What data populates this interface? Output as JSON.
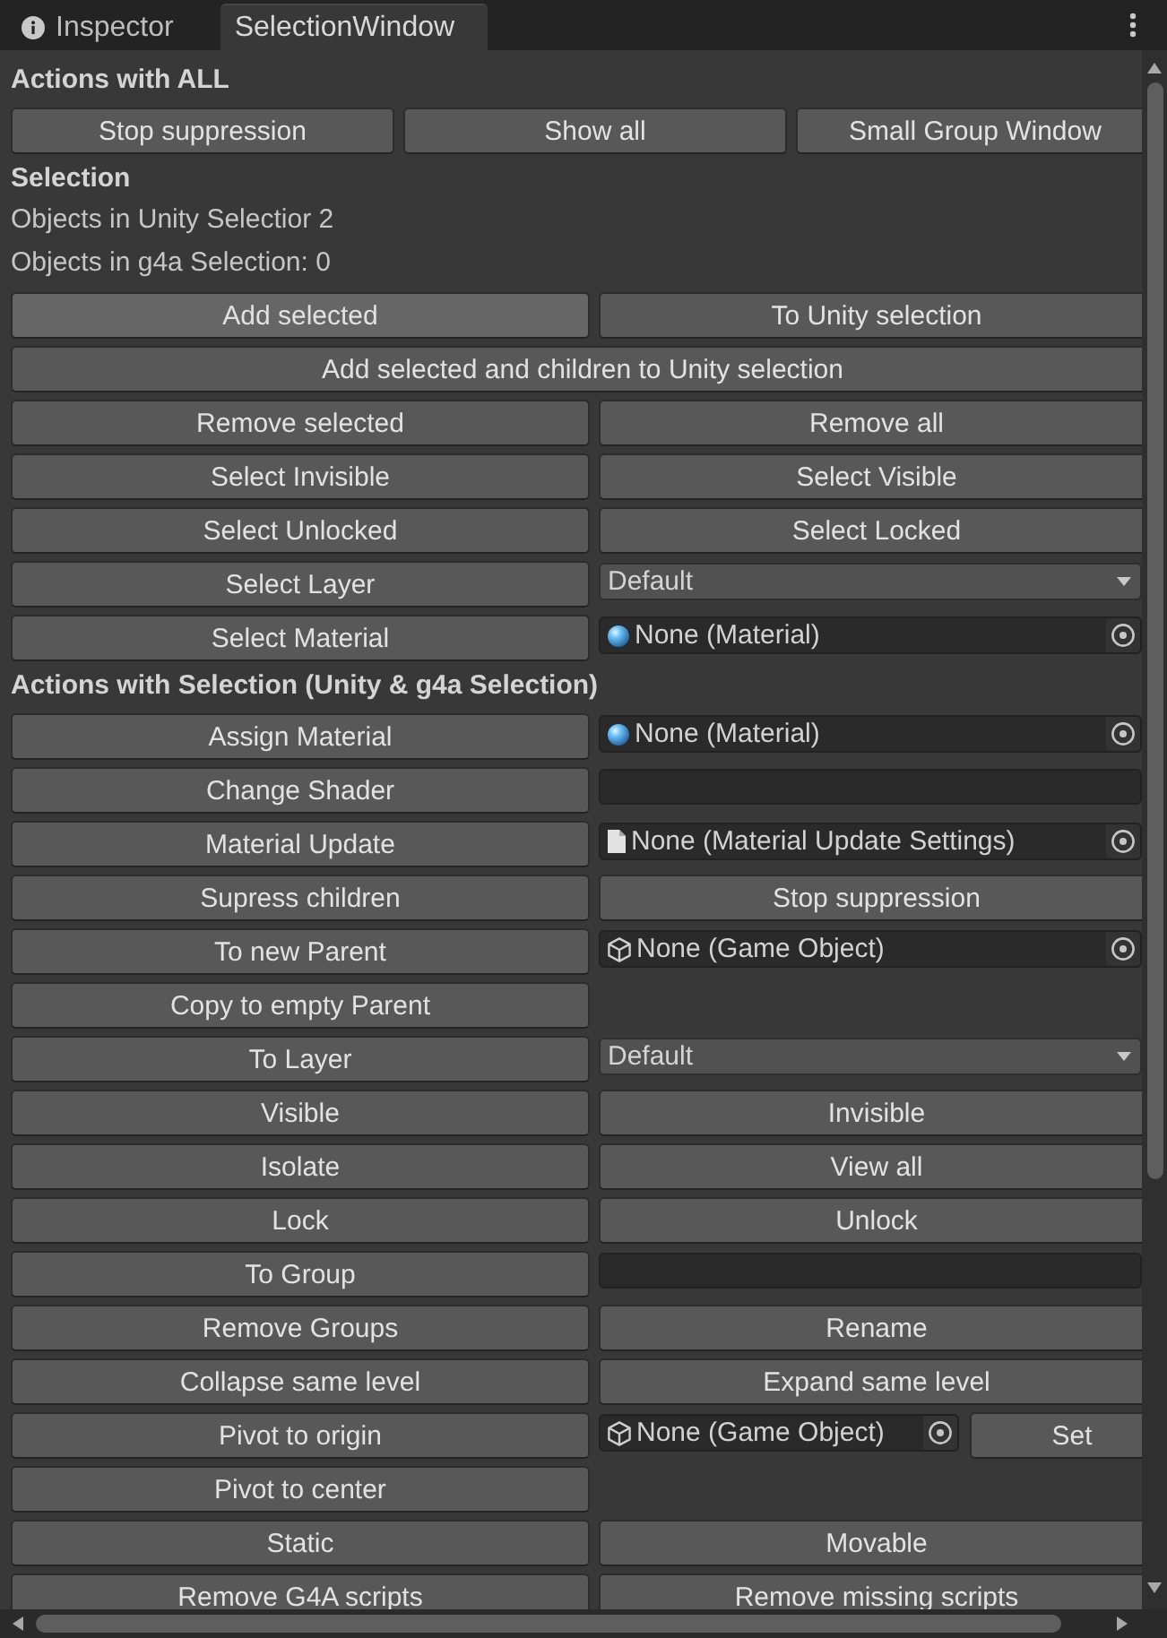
{
  "tabs": [
    {
      "label": "Inspector",
      "selected": false,
      "has_icon": true
    },
    {
      "label": "SelectionWindow",
      "selected": true,
      "has_icon": false
    }
  ],
  "content": [
    {
      "kind": "heading",
      "text": "Actions with ALL"
    },
    {
      "kind": "thirds",
      "cells": [
        {
          "kind": "button",
          "label": "Stop suppression",
          "hovered": false
        },
        {
          "kind": "button",
          "label": "Show all",
          "hovered": false
        },
        {
          "kind": "button",
          "label": "Small Group Window",
          "hovered": false
        }
      ]
    },
    {
      "kind": "heading",
      "text": "Selection"
    },
    {
      "kind": "text",
      "text": "Objects in Unity Selectior 2"
    },
    {
      "kind": "text",
      "text": "Objects in g4a Selection: 0"
    },
    {
      "kind": "halves",
      "cells": [
        {
          "kind": "button",
          "label": "Add selected",
          "hovered": true
        },
        {
          "kind": "button",
          "label": "To Unity selection",
          "hovered": false
        }
      ]
    },
    {
      "kind": "full",
      "cells": [
        {
          "kind": "button",
          "label": "Add selected and children to Unity selection",
          "hovered": false
        }
      ]
    },
    {
      "kind": "halves",
      "cells": [
        {
          "kind": "button",
          "label": "Remove selected",
          "hovered": false
        },
        {
          "kind": "button",
          "label": "Remove all",
          "hovered": false
        }
      ]
    },
    {
      "kind": "halves",
      "cells": [
        {
          "kind": "button",
          "label": "Select Invisible",
          "hovered": false
        },
        {
          "kind": "button",
          "label": "Select Visible",
          "hovered": false
        }
      ]
    },
    {
      "kind": "halves",
      "cells": [
        {
          "kind": "button",
          "label": "Select Unlocked",
          "hovered": false
        },
        {
          "kind": "button",
          "label": "Select Locked",
          "hovered": false
        }
      ]
    },
    {
      "kind": "halves",
      "cells": [
        {
          "kind": "button",
          "label": "Select Layer",
          "hovered": false
        },
        {
          "kind": "dropdown",
          "value": "Default"
        }
      ]
    },
    {
      "kind": "halves",
      "cells": [
        {
          "kind": "button",
          "label": "Select Material",
          "hovered": false
        },
        {
          "kind": "material_field",
          "value": "None (Material)"
        }
      ]
    },
    {
      "kind": "heading",
      "text": "Actions with Selection (Unity & g4a Selection)"
    },
    {
      "kind": "halves",
      "cells": [
        {
          "kind": "button",
          "label": "Assign Material",
          "hovered": false
        },
        {
          "kind": "material_field",
          "value": "None (Material)"
        }
      ]
    },
    {
      "kind": "halves",
      "cells": [
        {
          "kind": "button",
          "label": "Change Shader",
          "hovered": false
        },
        {
          "kind": "text_field"
        }
      ]
    },
    {
      "kind": "halves",
      "cells": [
        {
          "kind": "button",
          "label": "Material Update",
          "hovered": false
        },
        {
          "kind": "settings_field",
          "value": "None (Material Update Settings)"
        }
      ]
    },
    {
      "kind": "halves",
      "cells": [
        {
          "kind": "button",
          "label": "Supress children",
          "hovered": false
        },
        {
          "kind": "button",
          "label": "Stop suppression",
          "hovered": false
        }
      ]
    },
    {
      "kind": "halves",
      "cells": [
        {
          "kind": "button",
          "label": "To new Parent",
          "hovered": false
        },
        {
          "kind": "object_field",
          "value": "None (Game Object)"
        }
      ]
    },
    {
      "kind": "halves",
      "cells": [
        {
          "kind": "button",
          "label": "Copy to empty Parent",
          "hovered": false
        }
      ]
    },
    {
      "kind": "halves",
      "cells": [
        {
          "kind": "button",
          "label": "To Layer",
          "hovered": false
        },
        {
          "kind": "dropdown",
          "value": "Default"
        }
      ]
    },
    {
      "kind": "halves",
      "cells": [
        {
          "kind": "button",
          "label": "Visible",
          "hovered": false
        },
        {
          "kind": "button",
          "label": "Invisible",
          "hovered": false
        }
      ]
    },
    {
      "kind": "halves",
      "cells": [
        {
          "kind": "button",
          "label": "Isolate",
          "hovered": false
        },
        {
          "kind": "button",
          "label": "View all",
          "hovered": false
        }
      ]
    },
    {
      "kind": "halves",
      "cells": [
        {
          "kind": "button",
          "label": "Lock",
          "hovered": false
        },
        {
          "kind": "button",
          "label": "Unlock",
          "hovered": false
        }
      ]
    },
    {
      "kind": "halves",
      "cells": [
        {
          "kind": "button",
          "label": "To Group",
          "hovered": false
        },
        {
          "kind": "text_field"
        }
      ]
    },
    {
      "kind": "halves",
      "cells": [
        {
          "kind": "button",
          "label": "Remove Groups",
          "hovered": false
        },
        {
          "kind": "button",
          "label": "Rename",
          "hovered": false
        }
      ]
    },
    {
      "kind": "halves",
      "cells": [
        {
          "kind": "button",
          "label": "Collapse same level",
          "hovered": false
        },
        {
          "kind": "button",
          "label": "Expand same level",
          "hovered": false
        }
      ]
    },
    {
      "kind": "halves",
      "cells": [
        {
          "kind": "button",
          "label": "Pivot to origin",
          "hovered": false
        },
        {
          "kind": "object_field",
          "value": "None (Game Object)",
          "button": {
            "label": "Set",
            "hovered": false
          }
        }
      ]
    },
    {
      "kind": "halves",
      "cells": [
        {
          "kind": "button",
          "label": "Pivot to center",
          "hovered": false
        }
      ]
    },
    {
      "kind": "halves",
      "cells": [
        {
          "kind": "button",
          "label": "Static",
          "hovered": false
        },
        {
          "kind": "button",
          "label": "Movable",
          "hovered": false
        }
      ]
    },
    {
      "kind": "halves",
      "cells": [
        {
          "kind": "button",
          "label": "Remove G4A scripts",
          "hovered": false
        },
        {
          "kind": "button",
          "label": "Remove missing scripts",
          "hovered": false
        }
      ]
    }
  ]
}
